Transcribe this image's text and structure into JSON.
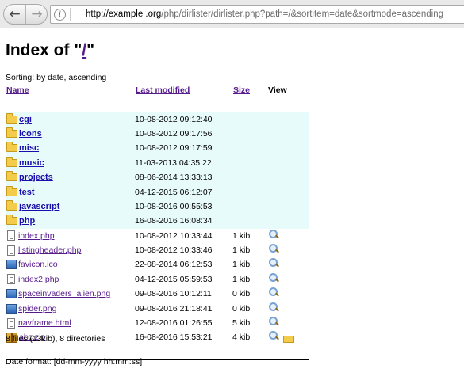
{
  "browser": {
    "url_host": "http://example .org",
    "url_path": "/php/dirlister/dirlister.php?path=/&sortitem=date&sortmode=ascending"
  },
  "page": {
    "title_prefix": "Index of \"",
    "title_link": "/",
    "title_suffix": "\"",
    "sorting": "Sorting: by date, ascending"
  },
  "table": {
    "headers": {
      "name": "Name",
      "modified": "Last modified",
      "size": "Size",
      "view": "View"
    },
    "directories": [
      {
        "name": "cgi",
        "date": "10-08-2012 09:12:40"
      },
      {
        "name": "icons",
        "date": "10-08-2012 09:17:56"
      },
      {
        "name": "misc",
        "date": "10-08-2012 09:17:59"
      },
      {
        "name": "music",
        "date": "11-03-2013 04:35:22"
      },
      {
        "name": "projects",
        "date": "08-06-2014 13:33:13"
      },
      {
        "name": "test",
        "date": "04-12-2015 06:12:07"
      },
      {
        "name": "javascript",
        "date": "10-08-2016 00:55:53"
      },
      {
        "name": "php",
        "date": "16-08-2016 16:08:34"
      }
    ],
    "files": [
      {
        "name": "index.php",
        "date": "10-08-2012 10:33:44",
        "size": "1 kib",
        "icon": "file-icon"
      },
      {
        "name": "listingheader.php",
        "date": "10-08-2012 10:33:46",
        "size": "1 kib",
        "icon": "file-icon"
      },
      {
        "name": "favicon.ico",
        "date": "22-08-2014 06:12:53",
        "size": "1 kib",
        "icon": "image-icon"
      },
      {
        "name": "index2.php",
        "date": "04-12-2015 05:59:53",
        "size": "1 kib",
        "icon": "file-icon"
      },
      {
        "name": "spaceinvaders_alien.png",
        "date": "09-08-2016 10:12:11",
        "size": "0 kib",
        "icon": "image-icon"
      },
      {
        "name": "spider.png",
        "date": "09-08-2016 21:18:41",
        "size": "0 kib",
        "icon": "image-icon"
      },
      {
        "name": "navframe.html",
        "date": "12-08-2016 01:26:55",
        "size": "5 kib",
        "icon": "file-icon"
      },
      {
        "name": "abc.zip",
        "date": "16-08-2016 15:53:21",
        "size": "4 kib",
        "icon": "zip-icon"
      }
    ]
  },
  "footer": {
    "summary": "8 files (13kib), 8 directories",
    "date_format": "Date format: [dd-mm-yyyy hh:mm:ss]"
  }
}
